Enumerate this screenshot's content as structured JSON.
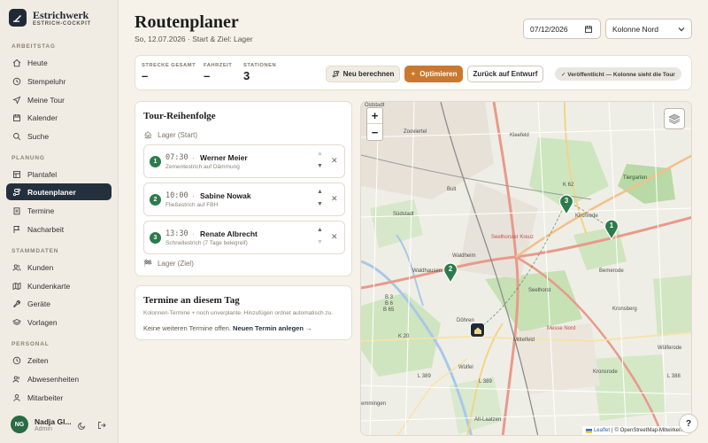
{
  "brand": {
    "name": "Estrichwerk",
    "subtitle": "ESTRICH-COCKPIT"
  },
  "sidebar": {
    "sections": [
      {
        "label": "ARBEITSTAG"
      },
      {
        "label": "PLANUNG"
      },
      {
        "label": "STAMMDATEN"
      },
      {
        "label": "PERSONAL"
      }
    ],
    "items": [
      {
        "label": "Heute",
        "icon": "home-icon"
      },
      {
        "label": "Stempeluhr",
        "icon": "clock-icon"
      },
      {
        "label": "Meine Tour",
        "icon": "navigation-icon"
      },
      {
        "label": "Kalender",
        "icon": "calendar-icon"
      },
      {
        "label": "Suche",
        "icon": "search-icon"
      },
      {
        "label": "Plantafel",
        "icon": "board-icon"
      },
      {
        "label": "Routenplaner",
        "icon": "route-icon",
        "active": true
      },
      {
        "label": "Termine",
        "icon": "clipboard-icon"
      },
      {
        "label": "Nacharbeit",
        "icon": "flag-icon"
      },
      {
        "label": "Kunden",
        "icon": "users-icon"
      },
      {
        "label": "Kundenkarte",
        "icon": "map-icon"
      },
      {
        "label": "Geräte",
        "icon": "wrench-icon"
      },
      {
        "label": "Vorlagen",
        "icon": "layers-icon"
      },
      {
        "label": "Zeiten",
        "icon": "clock-icon"
      },
      {
        "label": "Abwesenheiten",
        "icon": "people-icon"
      },
      {
        "label": "Mitarbeiter",
        "icon": "person-icon"
      }
    ]
  },
  "user": {
    "initials": "NG",
    "name": "Nadja Gl...",
    "role": "Admin"
  },
  "header": {
    "title": "Routenplaner",
    "subtitle": "So, 12.07.2026 · Start & Ziel: Lager",
    "date_value": "07/12/2026",
    "crew_select": "Kolonne Nord"
  },
  "stats": {
    "distance_label": "STRECKE GESAMT",
    "distance_value": "–",
    "time_label": "FAHRZEIT",
    "time_value": "–",
    "stations_label": "STATIONEN",
    "stations_value": "3"
  },
  "actions": {
    "recalc": "Neu berechnen",
    "optimize": "Optimieren",
    "back": "Zurück auf Entwurf",
    "published": "✓ Veröffentlicht — Kolonne sieht die Tour"
  },
  "tour": {
    "title": "Tour-Reihenfolge",
    "start": "Lager (Start)",
    "end": "Lager (Ziel)",
    "stops": [
      {
        "num": "1",
        "time": "07:30",
        "name": "Werner Meier",
        "desc": "Zementestrich auf Dämmung"
      },
      {
        "num": "2",
        "time": "10:00",
        "name": "Sabine Nowak",
        "desc": "Fließestrich auf FBH"
      },
      {
        "num": "3",
        "time": "13:30",
        "name": "Renate Albrecht",
        "desc": "Schnellestrich (7 Tage belegreif)"
      }
    ]
  },
  "termine": {
    "title": "Termine an diesem Tag",
    "subtitle": "Kolonnen-Termine + noch unverplante. Hinzufügen ordnet automatisch zu.",
    "empty": "Keine weiteren Termine offen.",
    "new_link": "Neuen Termin anlegen →"
  },
  "map": {
    "zoom_in": "+",
    "zoom_out": "−",
    "attribution_leaflet": "Leaflet",
    "attribution_osm": "© OpenStreetMap-Mitwirkende",
    "labels": [
      "Oststadt",
      "Zooviertel",
      "Kleefeld",
      "Tiergarten",
      "Bult",
      "Südstadt",
      "K 62",
      "Kirchrode",
      "Seelhorster Kreuz",
      "Waldheim",
      "Waldhausen",
      "Bemerode",
      "Seelhorst",
      "Döhren",
      "Mittelfeld",
      "Kronsberg",
      "Wülfel",
      "Wülferode",
      "K 20",
      "L 389",
      "L 388",
      "Kronsrode",
      "Alt-Laatzen",
      "emmingen",
      "B 3",
      "B 6",
      "B 65",
      "Messe Nord",
      "L 389"
    ],
    "markers": [
      "1",
      "2",
      "3"
    ]
  },
  "help": "?"
}
